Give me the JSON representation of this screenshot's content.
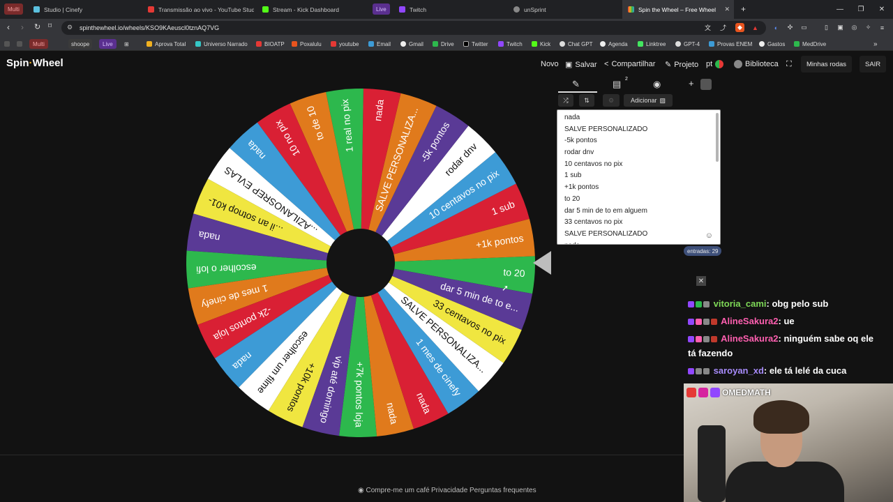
{
  "browser": {
    "tabs": [
      {
        "label": "Studio | Cinefy",
        "color": "#5bc0de"
      },
      {
        "label": "Transmissão ao vivo - YouTube Studio",
        "color": "#e53935"
      },
      {
        "label": "Stream - Kick Dashboard",
        "color": "#53fc18"
      },
      {
        "label": "Twitch",
        "color": "#9147ff"
      },
      {
        "label": "unSprint",
        "color": "#aaaaaa"
      },
      {
        "label": "Spin the Wheel – Free Wheel",
        "color": "#f0b020"
      }
    ],
    "groups": {
      "multi": "Multi",
      "live": "Live"
    },
    "url": "spinthewheel.io/wheels/KSO9KAeuscl0tznAQ7VG",
    "bookmarks": [
      "Multi",
      "shoope",
      "Live",
      "Aprova Total",
      "Universo Narrado",
      "BIOATP",
      "Poxalulu",
      "youtube",
      "Email",
      "Gmail",
      "Drive",
      "Twitter",
      "Twitch",
      "Kick",
      "Chat GPT",
      "Agenda",
      "Linktree",
      "GPT-4",
      "Provas ENEM",
      "Gastos",
      "MedDrive"
    ]
  },
  "app": {
    "logo": "Spin",
    "logo2": "Wheel",
    "menu": {
      "novo": "Novo",
      "salvar": "Salvar",
      "compartilhar": "Compartilhar",
      "projeto": "Projeto",
      "lang": "pt",
      "biblioteca": "Biblioteca",
      "minhas_rodas": "Minhas rodas",
      "sair": "SAIR"
    },
    "toolbar": {
      "adicionar": "Adicionar",
      "badge": "2"
    },
    "entries": [
      "nada",
      "SALVE PERSONALIZADO",
      "-5k pontos",
      "rodar dnv",
      "10 centavos no pix",
      "1 sub",
      "+1k pontos",
      "to 20",
      "dar 5 min de to em alguem",
      "33 centavos no pix",
      "SALVE PERSONALIZADO",
      "nada"
    ],
    "entries_count": "entradas: 29",
    "footer": {
      "coffee": "Compre-me um café",
      "privacy": "Privacidade",
      "faq": "Perguntas frequentes"
    }
  },
  "wheel": {
    "slices": [
      {
        "label": "to 20",
        "color": "#2db84d"
      },
      {
        "label": "+1k pontos",
        "color": "#e07a1c"
      },
      {
        "label": "1 sub",
        "color": "#d92034"
      },
      {
        "label": "10 centavos no pix",
        "color": "#3d9bd6"
      },
      {
        "label": "rodar dnv",
        "color": "#ffffff"
      },
      {
        "label": "-5k pontos",
        "color": "#5a3a96"
      },
      {
        "label": "SALVE PERSONALIZA...",
        "color": "#e07a1c"
      },
      {
        "label": "nada",
        "color": "#d92034"
      },
      {
        "label": "1 real no pix",
        "color": "#2db84d"
      },
      {
        "label": "to de 10",
        "color": "#e07a1c"
      },
      {
        "label": "10 no pix",
        "color": "#d92034"
      },
      {
        "label": "nada",
        "color": "#3d9bd6"
      },
      {
        "label": "...AZILANOSREP EVLAS",
        "color": "#ffffff"
      },
      {
        "label": "...il an sotnop k01-",
        "color": "#f0e640"
      },
      {
        "label": "nada",
        "color": "#5a3a96"
      },
      {
        "label": "escolher o lofi",
        "color": "#2db84d"
      },
      {
        "label": "1 mes de cinefy",
        "color": "#e07a1c"
      },
      {
        "label": "-2k pontos loja",
        "color": "#d92034"
      },
      {
        "label": "nada",
        "color": "#3d9bd6"
      },
      {
        "label": "escolher um filme",
        "color": "#ffffff"
      },
      {
        "label": "+10k pontos",
        "color": "#f0e640"
      },
      {
        "label": "vip até domingo",
        "color": "#5a3a96"
      },
      {
        "label": "+7k pontos loja",
        "color": "#2db84d"
      },
      {
        "label": "nada",
        "color": "#e07a1c"
      },
      {
        "label": "nada",
        "color": "#d92034"
      },
      {
        "label": "1 mes de cinefy",
        "color": "#3d9bd6"
      },
      {
        "label": "SALVE PERSONALIZA...",
        "color": "#ffffff"
      },
      {
        "label": "33 centavos no pix",
        "color": "#f0e640"
      },
      {
        "label": "dar 5 min de to e...",
        "color": "#5a3a96"
      }
    ]
  },
  "chat": [
    {
      "user": "vitoria_cami",
      "user_color": "#7ed957",
      "message": ": obg pelo sub"
    },
    {
      "user": "AlineSakura2",
      "user_color": "#ff5fb0",
      "message": ": ue"
    },
    {
      "user": "AlineSakura2",
      "user_color": "#ff5fb0",
      "message": ": ninguém sabe oq ele"
    },
    {
      "user": "",
      "user_color": "#ffffff",
      "message": "tá fazendo"
    },
    {
      "user": "saroyan_xd",
      "user_color": "#a78bfa",
      "message": ": ele tá lelé da cuca"
    }
  ],
  "stream_overlay": {
    "handle": "OMEDMATH"
  }
}
